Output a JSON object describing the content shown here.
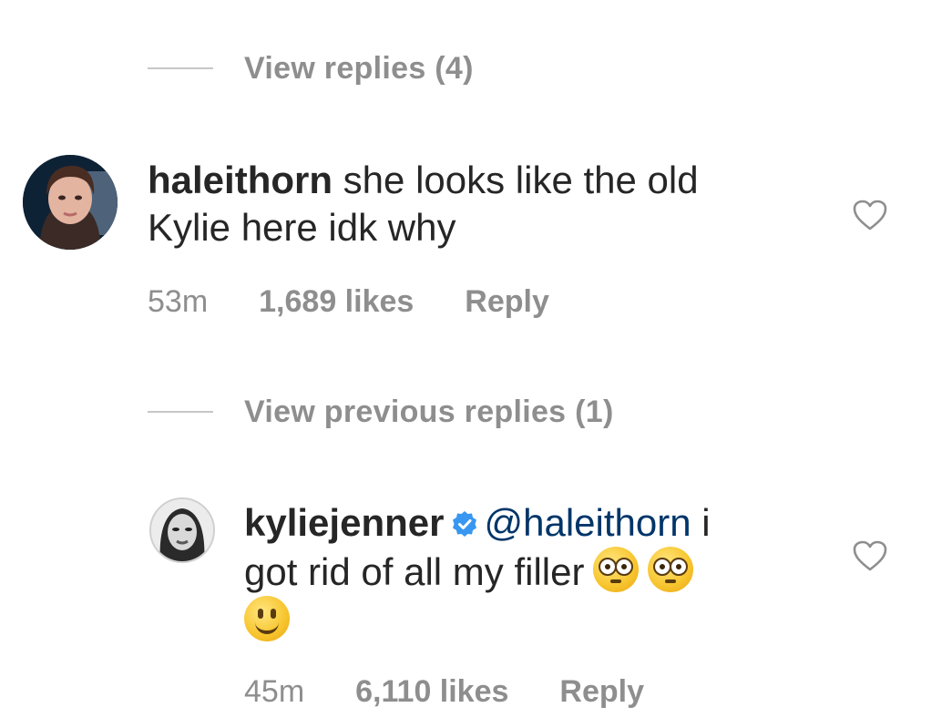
{
  "toggles": [
    {
      "label": "View replies (4)"
    },
    {
      "label": "View previous replies (1)"
    }
  ],
  "comments": [
    {
      "username": "haleithorn",
      "text_line1": " she looks like the old",
      "text_line2": "Kylie here idk why",
      "time": "53m",
      "likes": "1,689 likes",
      "reply": "Reply"
    },
    {
      "username": "kyliejenner",
      "mention": "@haleithorn",
      "text_after_mention": " i",
      "text_line2": "got rid of all my filler",
      "time": "45m",
      "likes": "6,110 likes",
      "reply": "Reply",
      "emojis": [
        "flushed-face",
        "flushed-face",
        "slightly-smiling-face"
      ]
    }
  ],
  "colors": {
    "text": "#262626",
    "muted": "#8e8e8e",
    "mention": "#003569",
    "verified": "#3897f0"
  }
}
